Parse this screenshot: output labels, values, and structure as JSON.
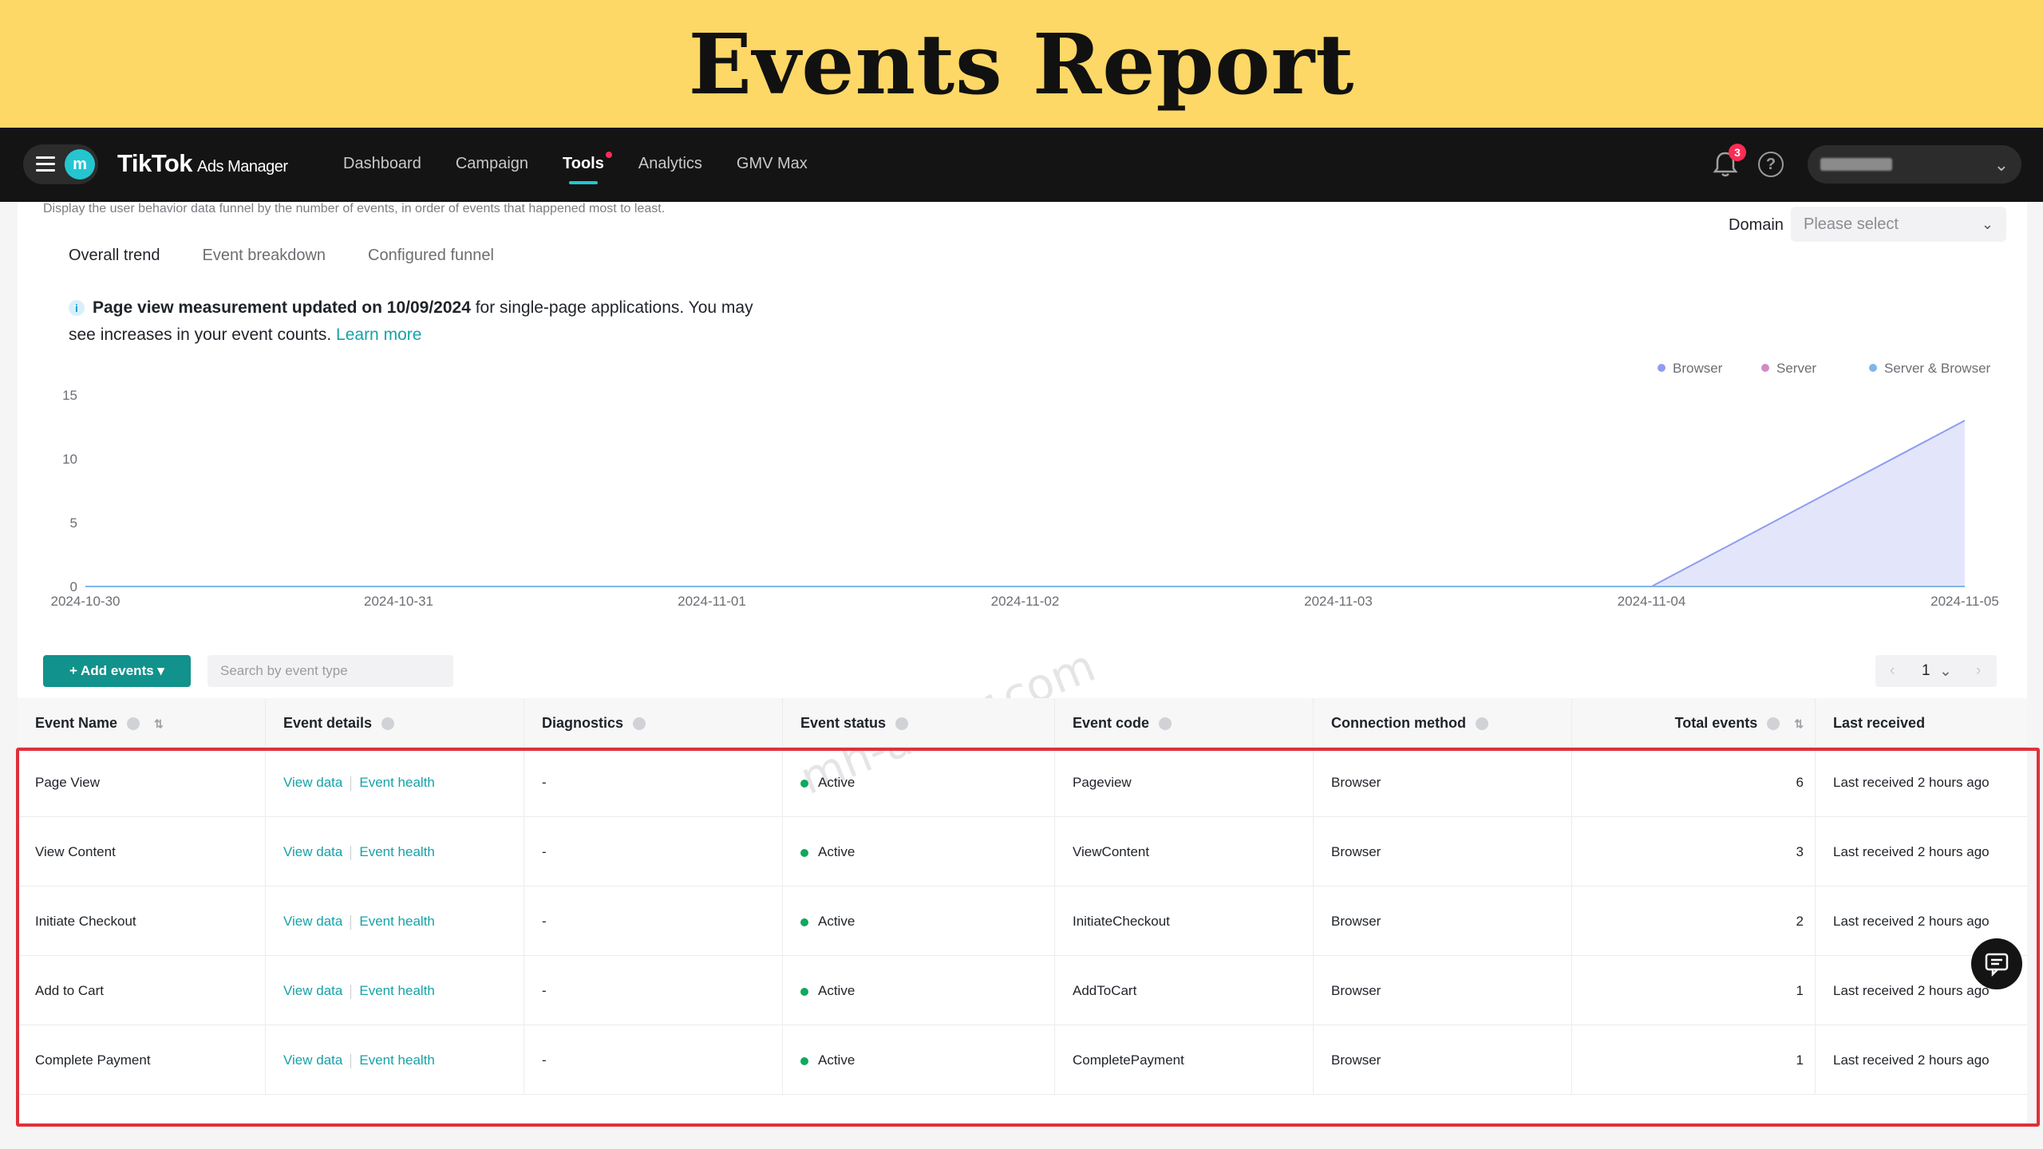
{
  "banner": {
    "title": "Events Report"
  },
  "nav": {
    "avatar_letter": "m",
    "brand": "TikTok",
    "brand_sub": "Ads Manager",
    "links": [
      "Dashboard",
      "Campaign",
      "Tools",
      "Analytics",
      "GMV Max"
    ],
    "active_link": "Tools",
    "notification_count": "3"
  },
  "content": {
    "description": "Display the user behavior data funnel by the number of events, in order of events that happened most to least.",
    "domain_label": "Domain",
    "domain_placeholder": "Please select",
    "tabs": [
      "Overall trend",
      "Event breakdown",
      "Configured funnel"
    ],
    "notice_bold": "Page view measurement updated on 10/09/2024",
    "notice_rest": " for single-page applications. You may see increases in your event counts.",
    "notice_link": "Learn more",
    "watermark": "mh-antor.com"
  },
  "chart_data": {
    "type": "area",
    "x": [
      "2024-10-30",
      "2024-10-31",
      "2024-11-01",
      "2024-11-02",
      "2024-11-03",
      "2024-11-04",
      "2024-11-05"
    ],
    "series": [
      {
        "name": "Browser",
        "values": [
          0,
          0,
          0,
          0,
          0,
          0,
          13
        ],
        "color": "#8f9cf0"
      },
      {
        "name": "Server",
        "values": [
          0,
          0,
          0,
          0,
          0,
          0,
          0
        ],
        "color": "#d08bc9"
      },
      {
        "name": "Server & Browser",
        "values": [
          0,
          0,
          0,
          0,
          0,
          0,
          0
        ],
        "color": "#7fb6e8"
      }
    ],
    "yticks": [
      "0",
      "5",
      "10",
      "15"
    ],
    "ylim": [
      0,
      15
    ],
    "legend": "top-right",
    "grid": false
  },
  "toolbar": {
    "add_events": "+ Add events ▾",
    "search_placeholder": "Search by event type",
    "page": "1"
  },
  "table": {
    "headers": [
      "Event Name",
      "Event details",
      "Diagnostics",
      "Event status",
      "Event code",
      "Connection method",
      "Total events",
      "Last received"
    ],
    "rows": [
      {
        "name": "Page View",
        "view": "View data",
        "health": "Event health",
        "diag": "-",
        "status": "Active",
        "code": "Pageview",
        "method": "Browser",
        "total": "6",
        "last": "Last received 2 hours ago"
      },
      {
        "name": "View Content",
        "view": "View data",
        "health": "Event health",
        "diag": "-",
        "status": "Active",
        "code": "ViewContent",
        "method": "Browser",
        "total": "3",
        "last": "Last received 2 hours ago"
      },
      {
        "name": "Initiate Checkout",
        "view": "View data",
        "health": "Event health",
        "diag": "-",
        "status": "Active",
        "code": "InitiateCheckout",
        "method": "Browser",
        "total": "2",
        "last": "Last received 2 hours ago"
      },
      {
        "name": "Add to Cart",
        "view": "View data",
        "health": "Event health",
        "diag": "-",
        "status": "Active",
        "code": "AddToCart",
        "method": "Browser",
        "total": "1",
        "last": "Last received 2 hours ago"
      },
      {
        "name": "Complete Payment",
        "view": "View data",
        "health": "Event health",
        "diag": "-",
        "status": "Active",
        "code": "CompletePayment",
        "method": "Browser",
        "total": "1",
        "last": "Last received 2 hours ago"
      }
    ]
  }
}
